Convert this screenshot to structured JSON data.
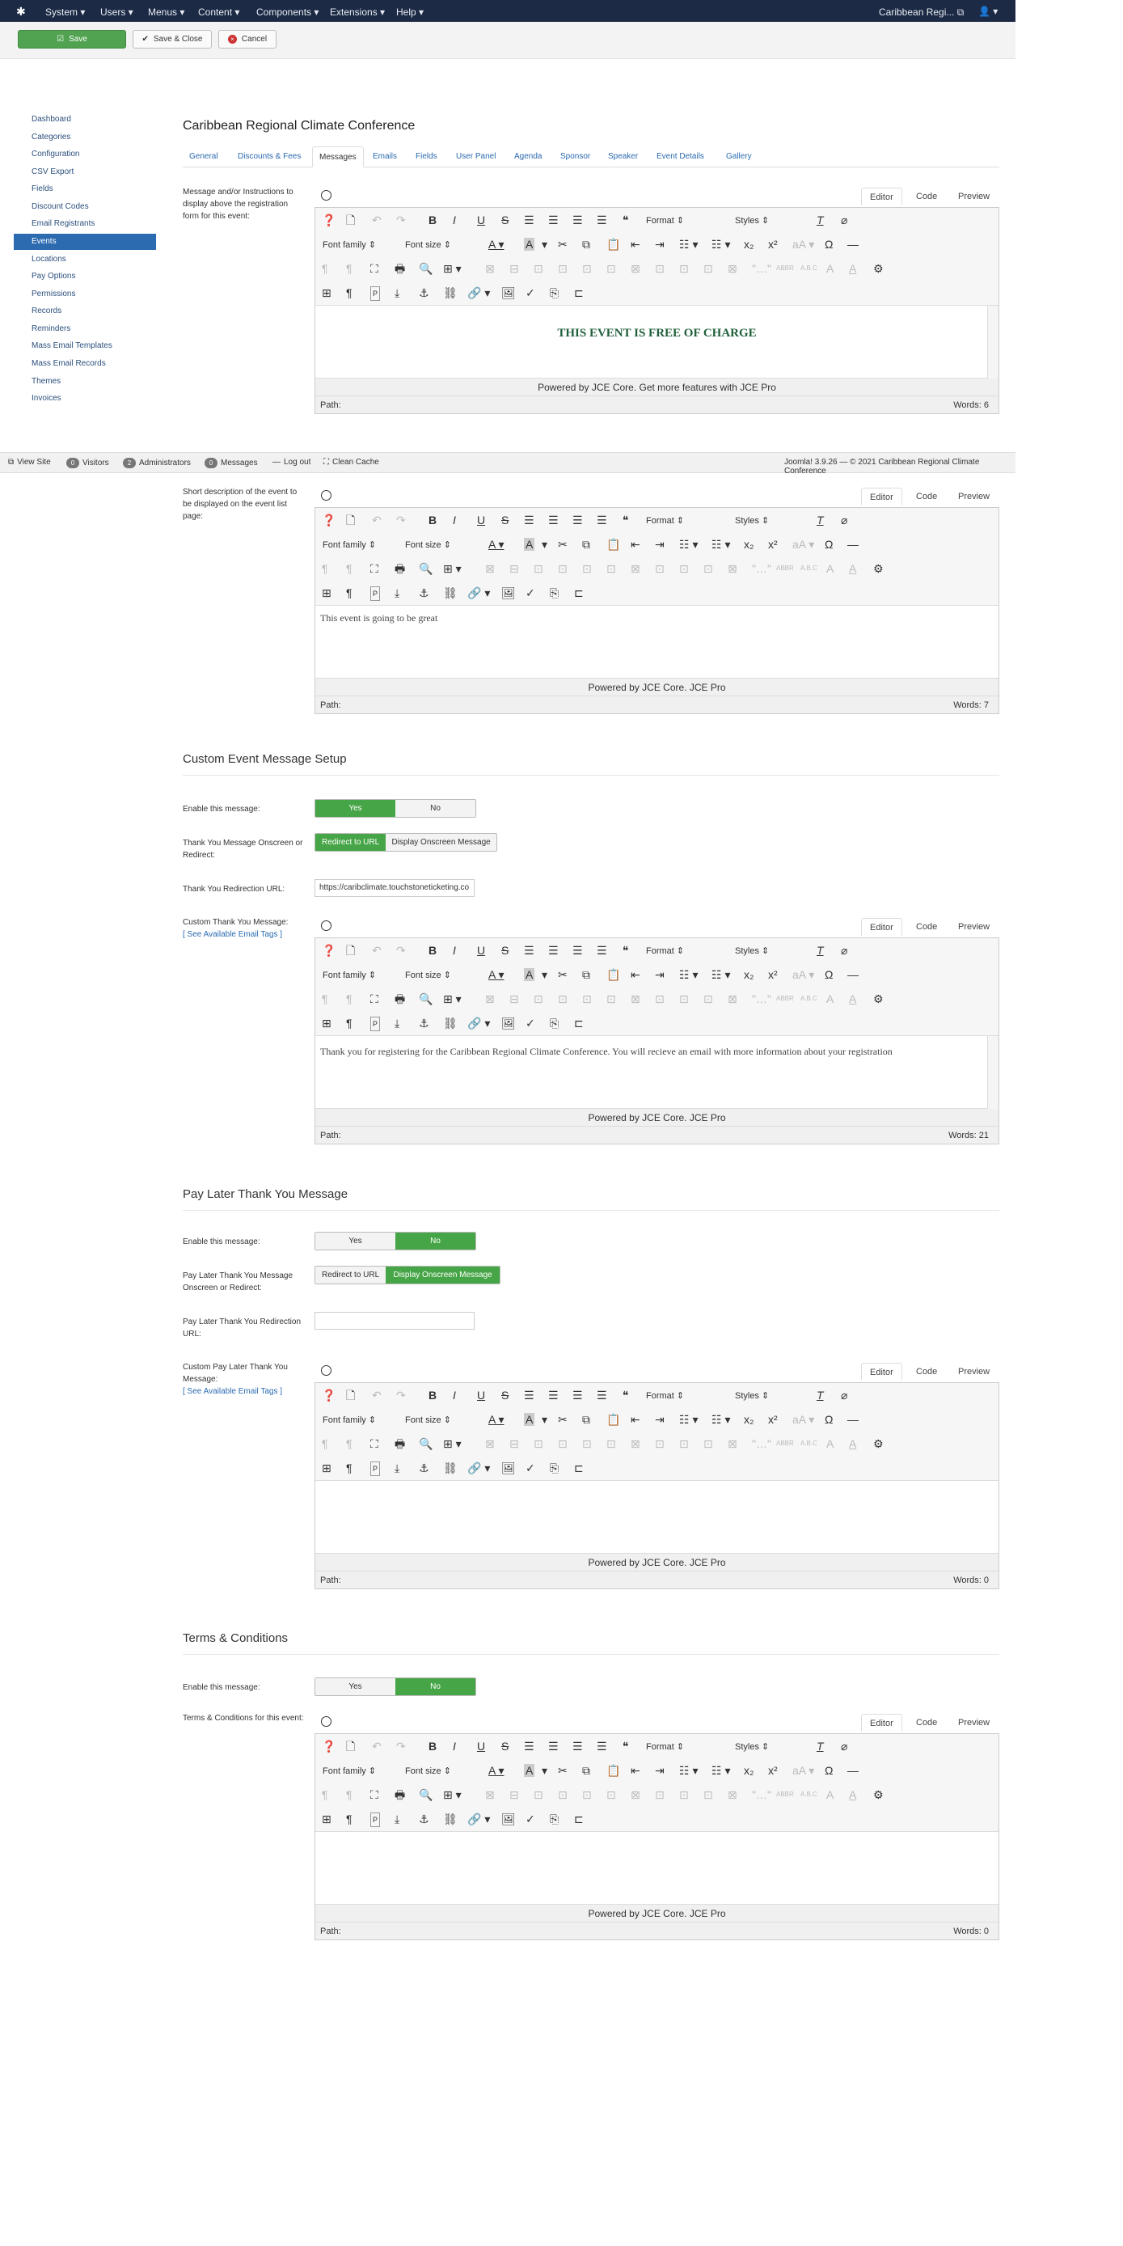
{
  "nav": {
    "menu": [
      "System",
      "Users",
      "Menus",
      "Content",
      "Components",
      "Extensions",
      "Help"
    ],
    "site_name": "Caribbean Regi...",
    "user_icon": "user-icon"
  },
  "toolbar": {
    "save": "Save",
    "save_close": "Save & Close",
    "cancel": "Cancel"
  },
  "sidebar": [
    "Dashboard",
    "Categories",
    "Configuration",
    "CSV Export",
    "Fields",
    "Discount Codes",
    "Email Registrants",
    "Events",
    "Locations",
    "Pay Options",
    "Permissions",
    "Records",
    "Reminders",
    "Mass Email Templates",
    "Mass Email Records",
    "Themes",
    "Invoices"
  ],
  "sidebar_active": "Events",
  "page_title": "Caribbean Regional Climate Conference",
  "tabs": [
    "General",
    "Discounts & Fees",
    "Messages",
    "Emails",
    "Fields",
    "User Panel",
    "Agenda",
    "Sponsor",
    "Speaker",
    "Event Details",
    "Gallery"
  ],
  "active_tab": "Messages",
  "editor_ui": {
    "editor": "Editor",
    "code": "Code",
    "preview": "Preview",
    "format": "Format",
    "styles": "Styles",
    "font_family": "Font family",
    "font_size": "Font size",
    "powered": "Powered by JCE Core. Get more features with JCE Pro",
    "powered_short": "Powered by JCE Core. JCE Pro",
    "path": "Path:"
  },
  "status_bar": {
    "view_site": "View Site",
    "visitors_count": "0",
    "visitors": "Visitors",
    "admins_count": "2",
    "admins": "Administrators",
    "messages_count": "0",
    "messages": "Messages",
    "logout": "Log out",
    "clean_cache": "Clean Cache",
    "footer": "Joomla! 3.9.26 — © 2021 Caribbean Regional Climate Conference"
  },
  "fields": {
    "message_label": "Message and/or Instructions to display above the registration form for this event:",
    "message_content": "THIS EVENT IS FREE OF CHARGE",
    "message_words": "Words: 6",
    "short_label": "Short description of the event to be displayed on the event list page:",
    "short_content": "This event is going to be great",
    "short_words": "Words: 7"
  },
  "custom_section": {
    "title": "Custom Event Message Setup",
    "enable_label": "Enable this message:",
    "yes": "Yes",
    "no": "No",
    "mode_label": "Thank You Message Onscreen or Redirect:",
    "redirect": "Redirect to URL",
    "onscreen": "Display Onscreen Message",
    "url_label": "Thank You Redirection URL:",
    "url_value": "https://caribclimate.touchstoneticketing.co",
    "msg_label": "Custom Thank You Message:",
    "email_tags": "[ See Available Email Tags ]",
    "msg_content": "Thank you for registering for the Caribbean Regional Climate Conference.  You will recieve an email with more information about your registration",
    "msg_words": "Words: 21"
  },
  "paylater_section": {
    "title": "Pay Later Thank You Message",
    "enable_label": "Enable this message:",
    "yes": "Yes",
    "no": "No",
    "mode_label": "Pay Later Thank You Message Onscreen or Redirect:",
    "redirect": "Redirect to URL",
    "onscreen": "Display Onscreen Message",
    "url_label": "Pay Later Thank You Redirection URL:",
    "url_value": "",
    "msg_label": "Custom Pay Later Thank You Message:",
    "email_tags": "[ See Available Email Tags ]",
    "msg_words": "Words: 0"
  },
  "terms_section": {
    "title": "Terms & Conditions",
    "enable_label": "Enable this message:",
    "yes": "Yes",
    "no": "No",
    "msg_label": "Terms & Conditions for this event:",
    "msg_words": "Words: 0"
  },
  "colors": {
    "nav": "#1c2a45",
    "active": "#2d6bb1",
    "toggle_on": "#46a546",
    "link": "#2a6ab0"
  }
}
